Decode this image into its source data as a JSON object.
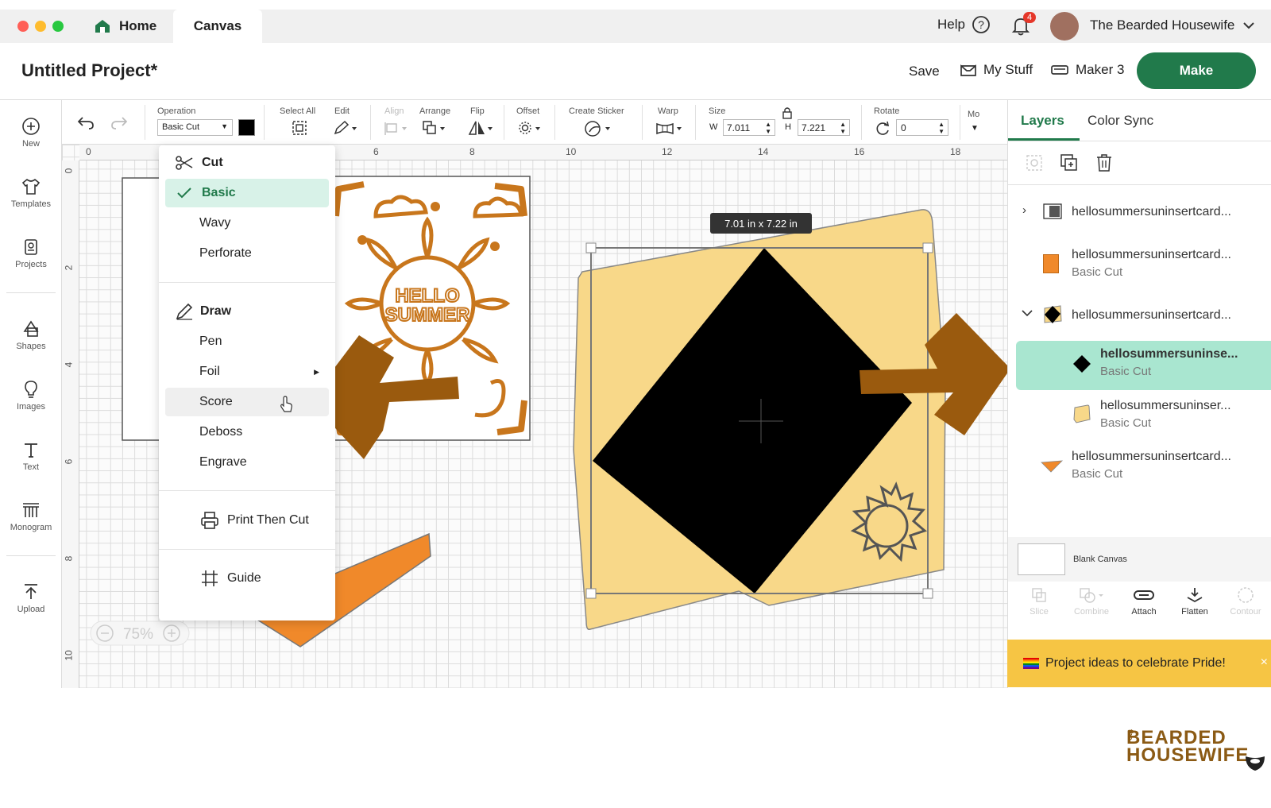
{
  "window": {
    "tabs": [
      {
        "label": "Home"
      },
      {
        "label": "Canvas"
      }
    ],
    "help_label": "Help",
    "notification_count": "4",
    "user_name": "The Bearded Housewife"
  },
  "header": {
    "project_title": "Untitled Project*",
    "save_label": "Save",
    "mystuff_label": "My Stuff",
    "machine_label": "Maker 3",
    "make_label": "Make"
  },
  "left_toolbar": {
    "items": [
      {
        "label": "New",
        "icon": "plus-circle-icon"
      },
      {
        "label": "Templates",
        "icon": "shirt-icon"
      },
      {
        "label": "Projects",
        "icon": "projects-icon"
      },
      {
        "label": "Shapes",
        "icon": "shapes-icon"
      },
      {
        "label": "Images",
        "icon": "bulb-icon"
      },
      {
        "label": "Text",
        "icon": "text-icon"
      },
      {
        "label": "Monogram",
        "icon": "monogram-icon"
      },
      {
        "label": "Upload",
        "icon": "upload-icon"
      }
    ]
  },
  "toolbar": {
    "operation_label": "Operation",
    "operation_value": "Basic Cut",
    "select_all_label": "Select All",
    "edit_label": "Edit",
    "align_label": "Align",
    "arrange_label": "Arrange",
    "flip_label": "Flip",
    "offset_label": "Offset",
    "create_sticker_label": "Create Sticker",
    "warp_label": "Warp",
    "size_label": "Size",
    "w_label": "W",
    "w_value": "7.011",
    "h_label": "H",
    "h_value": "7.221",
    "rotate_label": "Rotate",
    "rotate_value": "0",
    "more_label": "Mo"
  },
  "ruler": {
    "h_ticks": [
      "0",
      "6",
      "8",
      "10",
      "12",
      "14",
      "16",
      "18"
    ],
    "v_ticks": [
      "0",
      "2",
      "4",
      "6",
      "8",
      "10"
    ]
  },
  "canvas": {
    "size_tooltip": "7.01  in x 7.22  in",
    "card_text_line1": "HELLO",
    "card_text_line2": "SUMMER",
    "zoom_level": "75%"
  },
  "operation_menu": {
    "cut_header": "Cut",
    "cut_items": [
      "Basic",
      "Wavy",
      "Perforate"
    ],
    "draw_header": "Draw",
    "draw_items": [
      "Pen",
      "Foil",
      "Score",
      "Deboss",
      "Engrave"
    ],
    "print_then_cut": "Print Then Cut",
    "guide": "Guide",
    "selected": "Basic",
    "hovered": "Score"
  },
  "layers_panel": {
    "tabs": [
      "Layers",
      "Color Sync"
    ],
    "active_tab": "Layers",
    "layers": [
      {
        "name": "hellosummersuninsertcard...",
        "sub": ""
      },
      {
        "name": "hellosummersuninsertcard...",
        "sub": "Basic Cut"
      },
      {
        "name": "hellosummersuninsertcard...",
        "sub": ""
      },
      {
        "name": "hellosummersuninse...",
        "sub": "Basic Cut"
      },
      {
        "name": "hellosummersuninser...",
        "sub": "Basic Cut"
      },
      {
        "name": "hellosummersuninsertcard...",
        "sub": "Basic Cut"
      }
    ],
    "blank_canvas_label": "Blank Canvas",
    "bottom_tools": [
      "Slice",
      "Combine",
      "Attach",
      "Flatten",
      "Contour"
    ],
    "promo": "Project ideas to celebrate Pride!"
  },
  "watermark": {
    "line_small": "the",
    "line1": "BEARDED",
    "line2": "HOUSEWIFE"
  },
  "colors": {
    "accent_green": "#217a4b",
    "selected_layer": "#a9e6d0",
    "card_yellow": "#f8d889",
    "card_orange": "#f0892a",
    "arrow_brown": "#9a5a0e",
    "promo_yellow": "#f6c544"
  }
}
